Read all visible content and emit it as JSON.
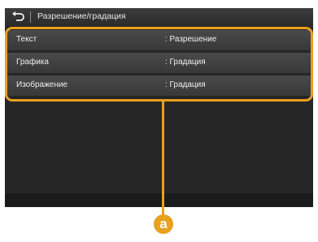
{
  "screen": {
    "title": "Разрешение/градация",
    "back_icon": "back-arrow-icon"
  },
  "settings": [
    {
      "label": "Текст",
      "value": ": Разрешение"
    },
    {
      "label": "Графика",
      "value": ": Градация"
    },
    {
      "label": "Изображение",
      "value": ": Градация"
    }
  ],
  "callout": {
    "badge": "a",
    "color": "#e9a01d"
  }
}
